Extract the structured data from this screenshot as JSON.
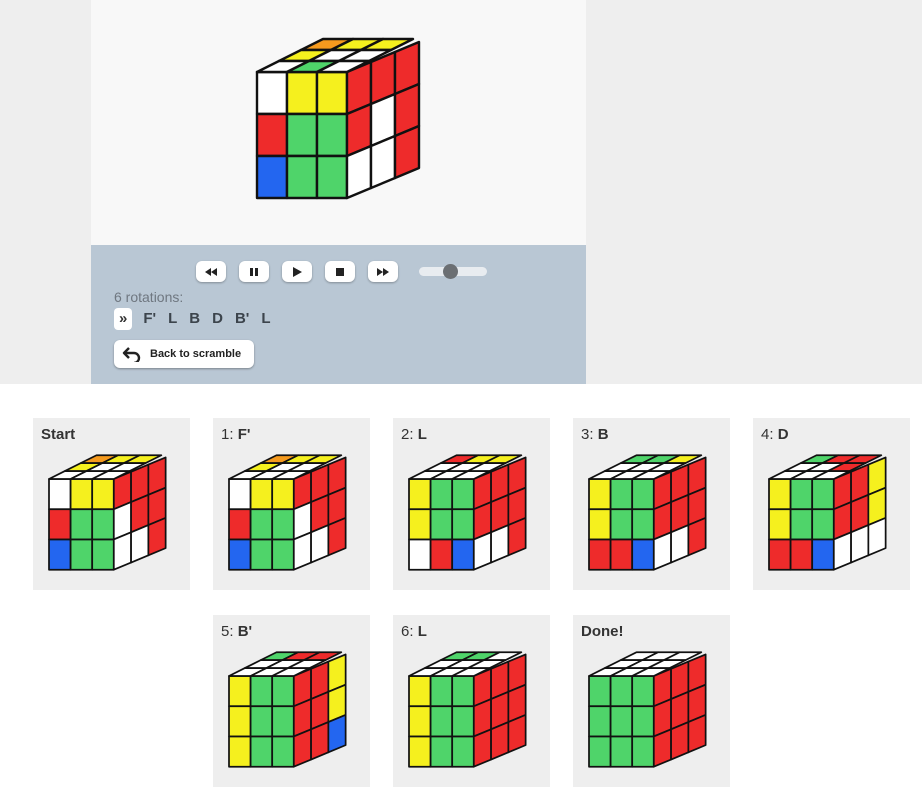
{
  "player": {
    "rotations_label": "6 rotations:",
    "moves": [
      "»",
      "F'",
      "L",
      "B",
      "D",
      "B'",
      "L"
    ],
    "back_label": "Back to scramble",
    "speed_level": 0.45
  },
  "controls": [
    "rewind-icon",
    "pause-icon",
    "play-icon",
    "stop-icon",
    "fast-forward-icon"
  ],
  "colors": {
    "W": "#ffffff",
    "Y": "#f5f01e",
    "G": "#4fd46a",
    "R": "#ee2b2b",
    "B": "#2366f0",
    "O": "#f59a1e",
    "w": "#ffffff",
    "y": "#f0ec80",
    "g": "#a6e4ad",
    "r": "#f08a8a",
    "b": "#8cb8f0",
    "o": "#f2c489"
  },
  "cards": [
    {
      "num": "",
      "move": "Start",
      "top": "OYYYWWWWW",
      "front": "WYYRGGBGG",
      "right": "RRRWRRWWR"
    },
    {
      "num": "1: ",
      "move": "F'",
      "top": "OYYYWWWWW",
      "front": "WYYRGGBGG",
      "right": "RRRWRRWWR"
    },
    {
      "num": "2: ",
      "move": "L",
      "top": "RYYWWWWWW",
      "front": "YGGYGGWRB",
      "right": "RRRRRRWWR"
    },
    {
      "num": "3: ",
      "move": "B",
      "top": "GGYWWWWWW",
      "front": "YGGYGGRRB",
      "right": "RRRRRRWWR"
    },
    {
      "num": "4: ",
      "move": "D",
      "top": "GRRWWRWWW",
      "front": "YGGYGGRRB",
      "right": "RRYRRYWWW"
    },
    {
      "num": "5: ",
      "move": "B'",
      "top": "GRRWWWWWW",
      "front": "YGGYGGYGG",
      "right": "RRYRRYRRB"
    },
    {
      "num": "6: ",
      "move": "L",
      "top": "GGWWWWWWW",
      "front": "YGGYGGYGG",
      "right": "RRRRRRRRR"
    },
    {
      "num": "",
      "move": "Done!",
      "top": "WWWWWWWWW",
      "front": "GGGGGGGGG",
      "right": "RRRRRRRRR"
    }
  ],
  "main_cube": {
    "top": "OYYYWWWGW",
    "front": "WYYRGGBGG",
    "right": "RRRRWRWWR"
  }
}
